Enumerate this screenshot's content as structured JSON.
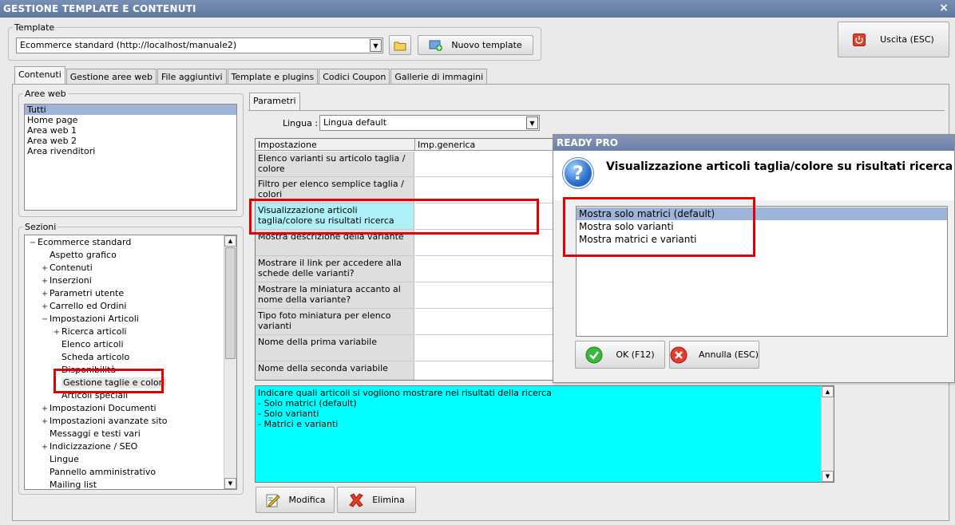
{
  "window": {
    "title": "GESTIONE TEMPLATE E CONTENUTI",
    "close_glyph": "×"
  },
  "template": {
    "group_label": "Template",
    "selected": "Ecommerce standard (http://localhost/manuale2)",
    "new_button": "Nuovo template"
  },
  "exit_button": "Uscita (ESC)",
  "tabs": [
    {
      "label": "Contenuti"
    },
    {
      "label": "Gestione aree web"
    },
    {
      "label": "File aggiuntivi"
    },
    {
      "label": "Template e plugins"
    },
    {
      "label": "Codici Coupon"
    },
    {
      "label": "Gallerie di immagini"
    }
  ],
  "aree_web": {
    "label": "Aree web",
    "items": [
      "Tutti",
      "Home page",
      "Area web 1",
      "Area web 2",
      "Area rivenditori"
    ]
  },
  "sezioni": {
    "label": "Sezioni",
    "tree": [
      {
        "label": "Ecommerce standard",
        "exp": "−"
      },
      {
        "label": "Aspetto grafico",
        "exp": ""
      },
      {
        "label": "Contenuti",
        "exp": "+"
      },
      {
        "label": "Inserzioni",
        "exp": "+"
      },
      {
        "label": "Parametri utente",
        "exp": "+"
      },
      {
        "label": "Carrello ed Ordini",
        "exp": "+"
      },
      {
        "label": "Impostazioni Articoli",
        "exp": "−"
      },
      {
        "label": "Ricerca articoli",
        "exp": "+"
      },
      {
        "label": "Elenco articoli",
        "exp": ""
      },
      {
        "label": "Scheda articolo",
        "exp": ""
      },
      {
        "label": "Disponibilità",
        "exp": ""
      },
      {
        "label": "Gestione taglie e colori",
        "exp": ""
      },
      {
        "label": "Articoli speciali",
        "exp": ""
      },
      {
        "label": "Impostazioni Documenti",
        "exp": "+"
      },
      {
        "label": "Impostazioni avanzate sito",
        "exp": "+"
      },
      {
        "label": "Messaggi e testi vari",
        "exp": ""
      },
      {
        "label": "Indicizzazione / SEO",
        "exp": "+"
      },
      {
        "label": "Lingue",
        "exp": ""
      },
      {
        "label": "Pannello amministrativo",
        "exp": ""
      },
      {
        "label": "Mailing list",
        "exp": ""
      }
    ]
  },
  "parametri": {
    "tab": "Parametri",
    "lingua_label": "Lingua :",
    "lingua_value": "Lingua default",
    "columns": [
      "Impostazione",
      "Imp.generica"
    ],
    "rows": [
      "Elenco varianti su articolo taglia / colore",
      "Filtro per elenco semplice taglia / colori",
      "Visualizzazione articoli taglia/colore su risultati ricerca",
      "Mostra descrizione della variante",
      "Mostrare il link per accedere alla schede delle varianti?",
      "Mostrare la miniatura accanto al nome della variante?",
      "Tipo foto miniatura per elenco varianti",
      "Nome della prima variabile",
      "Nome della seconda variabile"
    ],
    "description": [
      "Indicare quali articoli si vogliono mostrare nei risultati della ricerca",
      "- Solo matrici (default)",
      "- Solo varianti",
      "- Matrici e varianti"
    ],
    "modify_button": "Modifica",
    "delete_button": "Elimina"
  },
  "dialog": {
    "title": "READY PRO",
    "question": "Visualizzazione articoli taglia/colore su risultati ricerca",
    "options": [
      "Mostra solo matrici (default)",
      "Mostra solo varianti",
      "Mostra matrici e varianti"
    ],
    "ok": "OK (F12)",
    "cancel": "Annulla (ESC)"
  },
  "colors": {
    "highlight": "#e20000",
    "selection": "#9fb4d9",
    "description_bg": "#00ffff"
  }
}
